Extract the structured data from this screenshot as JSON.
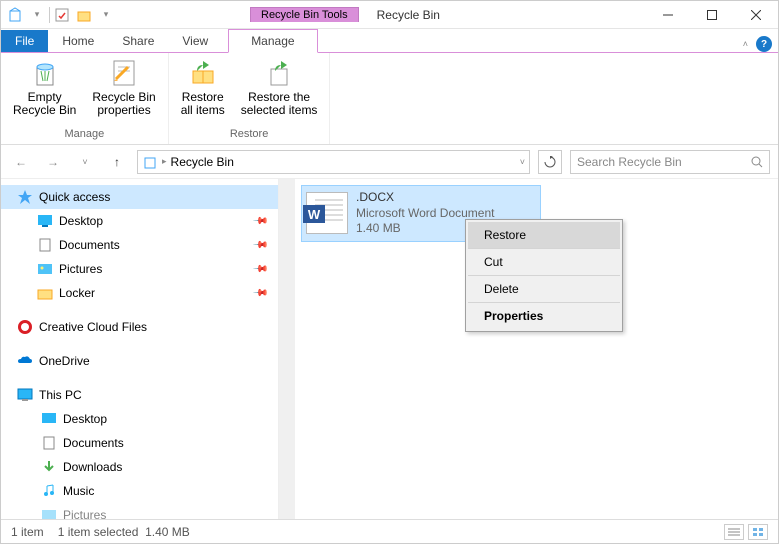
{
  "title": "Recycle Bin",
  "contextTab": "Recycle Bin Tools",
  "tabs": {
    "file": "File",
    "home": "Home",
    "share": "Share",
    "view": "View",
    "manage": "Manage"
  },
  "ribbon": {
    "manage": {
      "label": "Manage",
      "empty": "Empty\nRecycle Bin",
      "props": "Recycle Bin\nproperties"
    },
    "restore": {
      "label": "Restore",
      "all": "Restore\nall items",
      "sel": "Restore the\nselected items"
    }
  },
  "address": {
    "path": "Recycle Bin",
    "searchPlaceholder": "Search Recycle Bin"
  },
  "tree": {
    "quickaccess": "Quick access",
    "items": [
      "Desktop",
      "Documents",
      "Pictures",
      "Locker"
    ],
    "ccf": "Creative Cloud Files",
    "onedrive": "OneDrive",
    "thispc": "This PC",
    "pc": [
      "Desktop",
      "Documents",
      "Downloads",
      "Music",
      "Pictures"
    ]
  },
  "file": {
    "name": ".DOCX",
    "type": "Microsoft Word Document",
    "size": "1.40 MB"
  },
  "context": {
    "restore": "Restore",
    "cut": "Cut",
    "delete": "Delete",
    "properties": "Properties"
  },
  "status": {
    "count": "1 item",
    "sel": "1 item selected",
    "size": "1.40 MB"
  }
}
